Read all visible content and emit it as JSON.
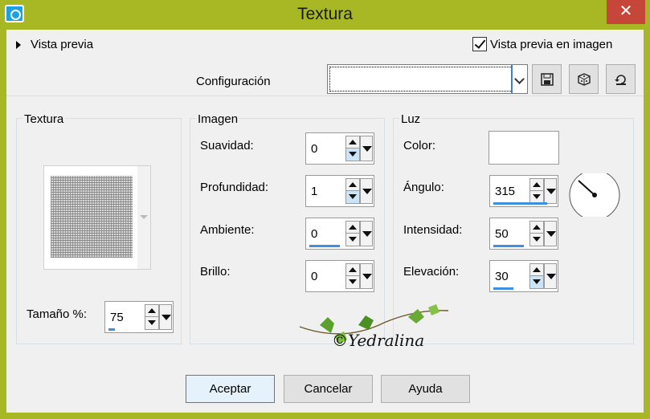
{
  "window": {
    "title": "Textura",
    "close_glyph": "✕"
  },
  "top": {
    "preview_toggle_label": "Vista previa",
    "preview_in_image_label": "Vista previa en imagen",
    "preview_in_image_checked": true
  },
  "config": {
    "label": "Configuración",
    "value": ""
  },
  "texture_group": {
    "title": "Textura",
    "size_label": "Tamaño %:",
    "size_value": "75",
    "size_fill": 0.1
  },
  "image_group": {
    "title": "Imagen",
    "fields": [
      {
        "label": "Suavidad:",
        "value": "0",
        "fill": 0.0
      },
      {
        "label": "Profundidad:",
        "value": "1",
        "fill": 0.0
      },
      {
        "label": "Ambiente:",
        "value": "0",
        "fill": 0.5
      },
      {
        "label": "Brillo:",
        "value": "0",
        "fill": 0.0
      }
    ]
  },
  "light_group": {
    "title": "Luz",
    "color_label": "Color:",
    "color_value": "#ffffff",
    "angle_label": "Ángulo:",
    "angle_value": "315",
    "angle_fill": 0.875,
    "intensity_label": "Intensidad:",
    "intensity_value": "50",
    "intensity_fill": 0.5,
    "elevation_label": "Elevación:",
    "elevation_value": "30",
    "elevation_fill": 0.33
  },
  "buttons": {
    "ok": "Aceptar",
    "cancel": "Cancelar",
    "help": "Ayuda"
  },
  "watermark": {
    "text": "©Yedralina"
  },
  "colors": {
    "title_bar": "#a8b825",
    "close": "#c7463a",
    "accent": "#3d8fe0"
  },
  "icons": [
    "app-icon",
    "save-icon",
    "randomize-icon",
    "reset-icon",
    "close-icon",
    "expand-triangle-icon",
    "check-icon",
    "angle-dial-icon"
  ]
}
